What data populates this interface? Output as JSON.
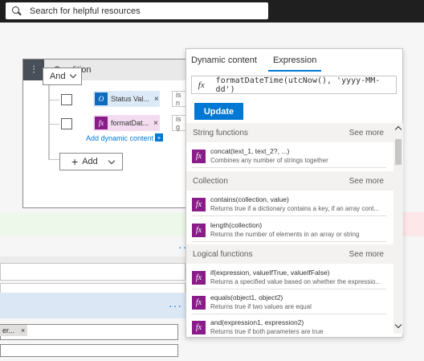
{
  "search": {
    "placeholder": "Search for helpful resources"
  },
  "condition": {
    "title": "Condition",
    "and_label": "And",
    "rows": [
      {
        "token": "Status Val...",
        "icon": "outlook-icon",
        "operator": "is n"
      },
      {
        "token": "formatDat...",
        "icon": "fx-icon",
        "operator": "is g"
      }
    ],
    "add_dynamic": "Add dynamic content",
    "add_button": "Add"
  },
  "left_tag": "er...",
  "panel": {
    "tabs": [
      "Dynamic content",
      "Expression"
    ],
    "active_tab": "Expression",
    "expression": "formatDateTime(utcNow(), 'yyyy-MM-dd')",
    "update_label": "Update",
    "groups": [
      {
        "name": "String functions",
        "see_more": "See more",
        "functions": [
          {
            "sig": "concat(text_1, text_2?, ...)",
            "desc": "Combines any number of strings together"
          }
        ]
      },
      {
        "name": "Collection",
        "see_more": "See more",
        "functions": [
          {
            "sig": "contains(collection, value)",
            "desc": "Returns true if a dictionary contains a key, if an array cont..."
          },
          {
            "sig": "length(collection)",
            "desc": "Returns the number of elements in an array or string"
          }
        ]
      },
      {
        "name": "Logical functions",
        "see_more": "See more",
        "functions": [
          {
            "sig": "if(expression, valueIfTrue, valueIfFalse)",
            "desc": "Returns a specified value based on whether the expressio..."
          },
          {
            "sig": "equals(object1, object2)",
            "desc": "Returns true if two values are equal"
          },
          {
            "sig": "and(expression1, expression2)",
            "desc": "Returns true if both parameters are true"
          }
        ]
      }
    ]
  },
  "side_link": "on",
  "colors": {
    "accent": "#0078d4",
    "fx": "#8a1c8a",
    "outlook": "#0f6cbd"
  }
}
